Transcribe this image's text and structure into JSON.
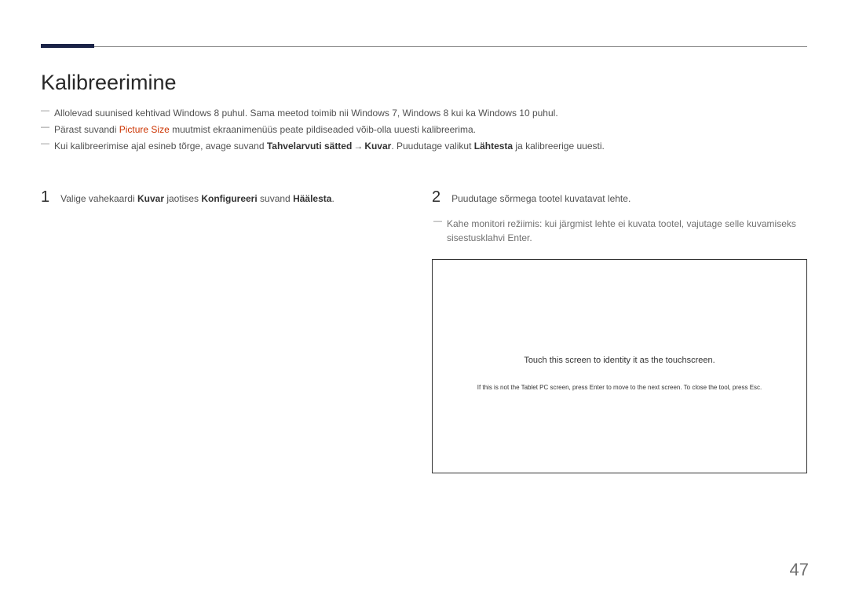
{
  "title": "Kalibreerimine",
  "intro": [
    {
      "prefix": "Allolevad suunised kehtivad Windows 8 puhul. Sama meetod toimib nii Windows 7, Windows 8 kui ka Windows 10 puhul.",
      "segments": [
        {
          "text": "Allolevad suunised kehtivad Windows 8 puhul. Sama meetod toimib nii Windows 7, Windows 8 kui ka Windows 10 puhul.",
          "style": "normal"
        }
      ]
    },
    {
      "segments": [
        {
          "text": "Pärast suvandi ",
          "style": "normal"
        },
        {
          "text": "Picture Size",
          "style": "red"
        },
        {
          "text": " muutmist ekraanimenüüs peate pildiseaded võib-olla uuesti kalibreerima.",
          "style": "normal"
        }
      ]
    },
    {
      "segments": [
        {
          "text": "Kui kalibreerimise ajal esineb tõrge, avage suvand ",
          "style": "normal"
        },
        {
          "text": "Tahvelarvuti sätted",
          "style": "bold"
        },
        {
          "text": " → ",
          "style": "arrow"
        },
        {
          "text": "Kuvar",
          "style": "bold"
        },
        {
          "text": ". Puudutage valikut ",
          "style": "normal"
        },
        {
          "text": "Lähtesta",
          "style": "bold"
        },
        {
          "text": " ja kalibreerige uuesti.",
          "style": "normal"
        }
      ]
    }
  ],
  "step1": {
    "num": "1",
    "segments": [
      {
        "text": "Valige vahekaardi ",
        "style": "normal"
      },
      {
        "text": "Kuvar",
        "style": "bold"
      },
      {
        "text": " jaotises ",
        "style": "normal"
      },
      {
        "text": "Konfigureeri",
        "style": "bold"
      },
      {
        "text": " suvand ",
        "style": "normal"
      },
      {
        "text": "Häälesta",
        "style": "bold"
      },
      {
        "text": ".",
        "style": "normal"
      }
    ]
  },
  "step2": {
    "num": "2",
    "text": "Puudutage sõrmega tootel kuvatavat lehte.",
    "note": "Kahe monitori režiimis: kui järgmist lehte ei kuvata tootel, vajutage selle kuvamiseks sisestusklahvi Enter."
  },
  "screen": {
    "line1": "Touch this screen to identity it as the touchscreen.",
    "line2": "If this is not the Tablet PC screen, press Enter to move to the next screen. To close the tool, press Esc."
  },
  "pageNumber": "47"
}
